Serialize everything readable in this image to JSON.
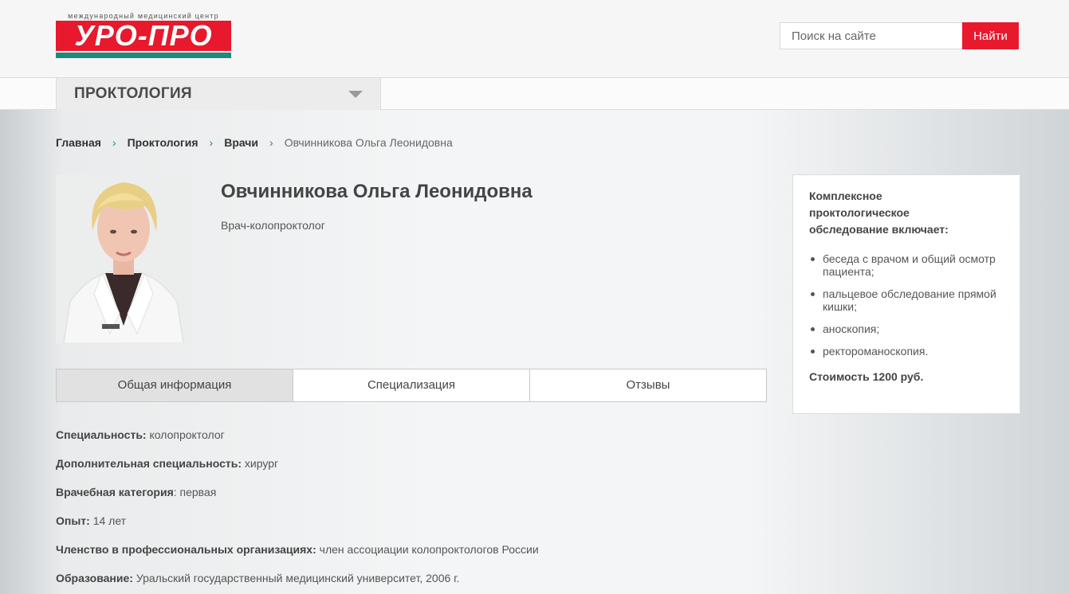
{
  "header": {
    "logo_subtitle": "международный медицинский центр",
    "logo_title": "УРО-ПРО",
    "search_placeholder": "Поиск на сайте",
    "search_button": "Найти"
  },
  "nav": {
    "section_label": "ПРОКТОЛОГИЯ"
  },
  "breadcrumb": {
    "items": [
      "Главная",
      "Проктология",
      "Врачи"
    ],
    "current": "Овчинникова Ольга Леонидовна"
  },
  "doctor": {
    "name": "Овчинникова Ольга Леонидовна",
    "position": "Врач-колопроктолог"
  },
  "tabs": [
    {
      "label": "Общая информация"
    },
    {
      "label": "Специализация"
    },
    {
      "label": "Отзывы"
    }
  ],
  "info": [
    {
      "label": "Специальность:",
      "value": "колопроктолог"
    },
    {
      "label": "Дополнительная специальность:",
      "value": "хирург"
    },
    {
      "label": "Врачебная категория",
      "value": ": первая"
    },
    {
      "label": "Опыт:",
      "value": "14 лет"
    },
    {
      "label": "Членство в профессиональных организациях:",
      "value": "член ассоциации колопроктологов России"
    },
    {
      "label": "Образование:",
      "value": "Уральский государственный медицинский университет, 2006 г."
    }
  ],
  "sidebar": {
    "title": "Комплексное проктологическое обследование включает:",
    "items": [
      "беседа с врачом и общий осмотр пациента;",
      "пальцевое обследование прямой кишки;",
      "аноскопия;",
      "ректороманоскопия."
    ],
    "price": "Стоимость 1200 руб."
  },
  "colors": {
    "accent_red": "#e8192c",
    "accent_teal": "#1c8a7d"
  }
}
